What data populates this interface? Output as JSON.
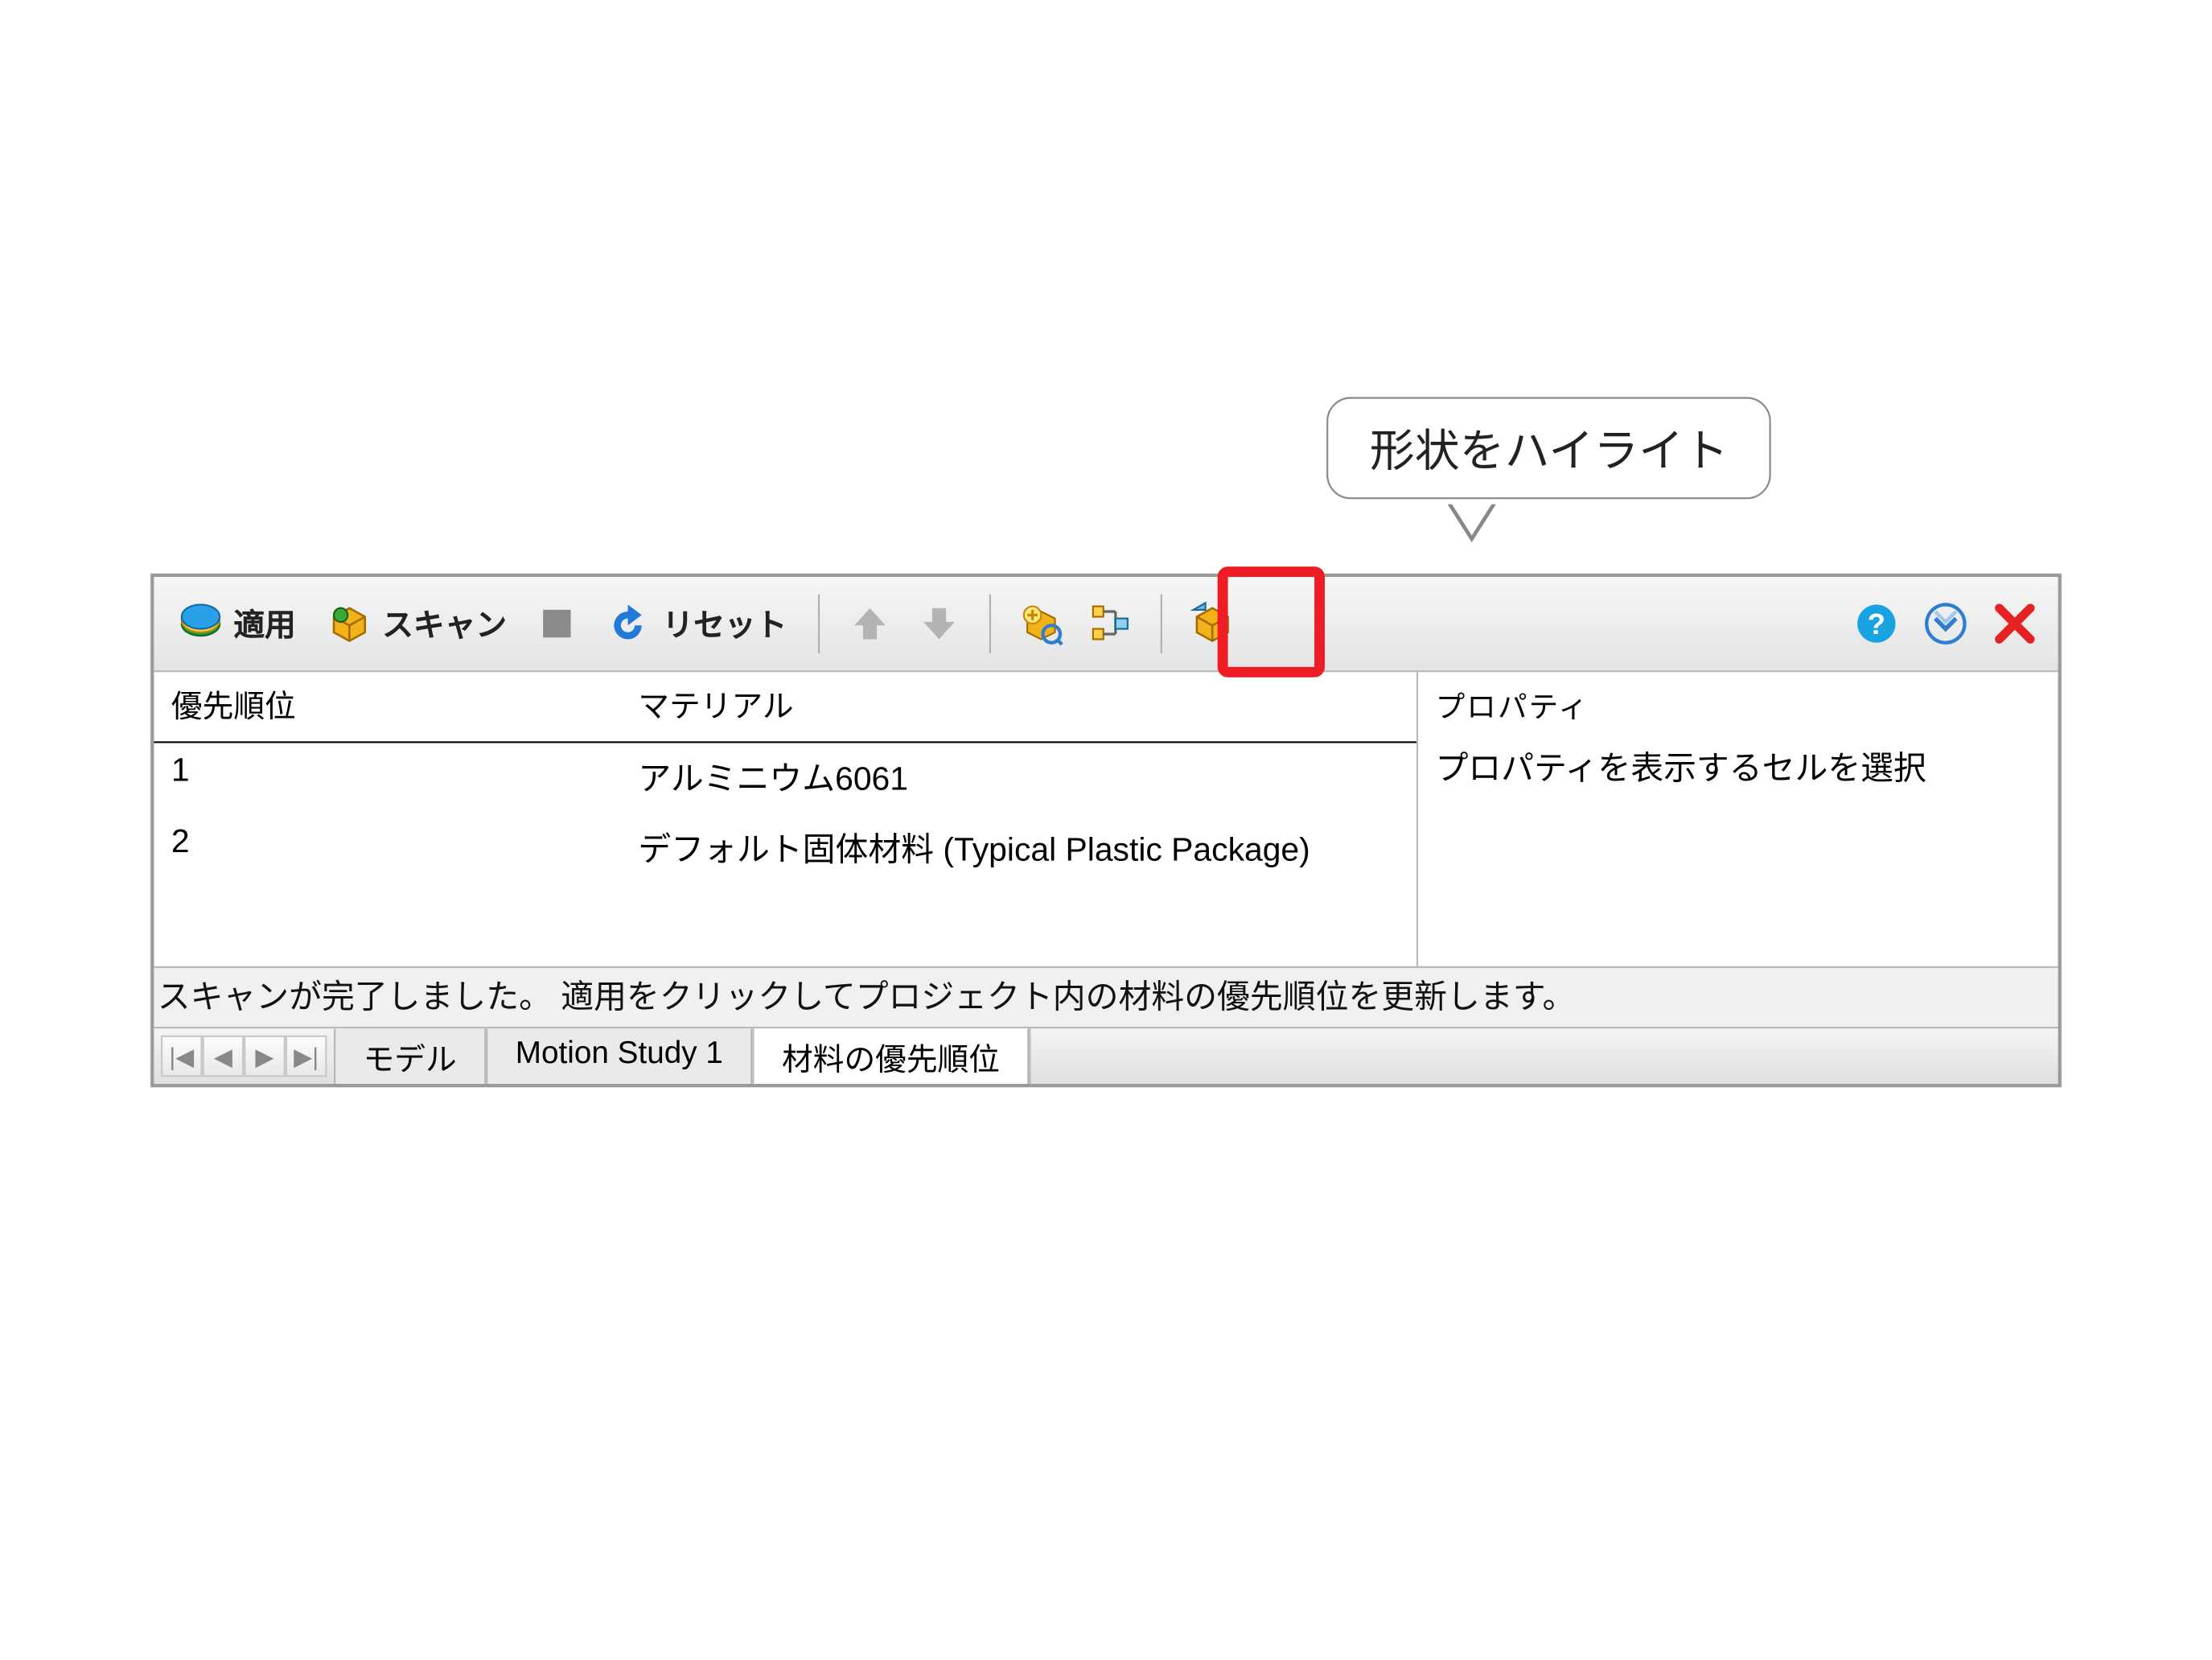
{
  "callout": {
    "text": "形状をハイライト"
  },
  "toolbar": {
    "apply_label": "適用",
    "scan_label": "スキャン",
    "reset_label": "リセット"
  },
  "table": {
    "headers": {
      "priority": "優先順位",
      "material": "マテリアル"
    },
    "rows": [
      {
        "priority": "1",
        "material": "アルミニウム6061"
      },
      {
        "priority": "2",
        "material": "デフォルト固体材料 (Typical Plastic Package)"
      }
    ]
  },
  "properties": {
    "header": "プロパティ",
    "message": "プロパティを表示するセルを選択"
  },
  "status": {
    "text": "スキャンが完了しました。 適用をクリックしてプロジェクト内の材料の優先順位を更新します。"
  },
  "tabs": {
    "items": [
      {
        "label": "モデル"
      },
      {
        "label": "Motion Study 1"
      },
      {
        "label": "材料の優先順位"
      }
    ]
  }
}
